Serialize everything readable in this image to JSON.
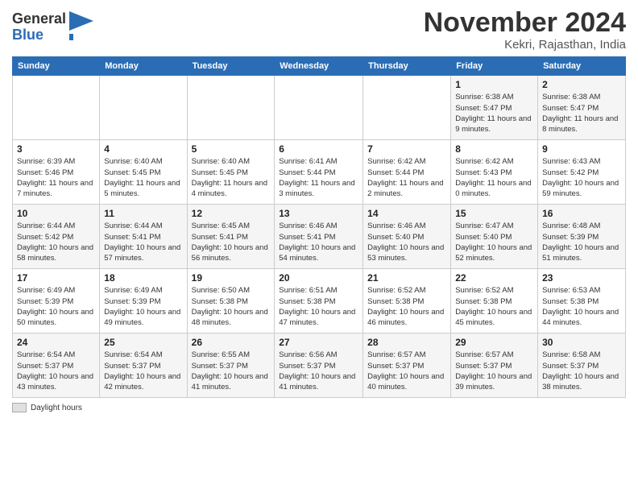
{
  "logo": {
    "general": "General",
    "blue": "Blue"
  },
  "header": {
    "month": "November 2024",
    "location": "Kekri, Rajasthan, India"
  },
  "days_of_week": [
    "Sunday",
    "Monday",
    "Tuesday",
    "Wednesday",
    "Thursday",
    "Friday",
    "Saturday"
  ],
  "weeks": [
    [
      {
        "day": "",
        "info": ""
      },
      {
        "day": "",
        "info": ""
      },
      {
        "day": "",
        "info": ""
      },
      {
        "day": "",
        "info": ""
      },
      {
        "day": "",
        "info": ""
      },
      {
        "day": "1",
        "info": "Sunrise: 6:38 AM\nSunset: 5:47 PM\nDaylight: 11 hours and 9 minutes."
      },
      {
        "day": "2",
        "info": "Sunrise: 6:38 AM\nSunset: 5:47 PM\nDaylight: 11 hours and 8 minutes."
      }
    ],
    [
      {
        "day": "3",
        "info": "Sunrise: 6:39 AM\nSunset: 5:46 PM\nDaylight: 11 hours and 7 minutes."
      },
      {
        "day": "4",
        "info": "Sunrise: 6:40 AM\nSunset: 5:45 PM\nDaylight: 11 hours and 5 minutes."
      },
      {
        "day": "5",
        "info": "Sunrise: 6:40 AM\nSunset: 5:45 PM\nDaylight: 11 hours and 4 minutes."
      },
      {
        "day": "6",
        "info": "Sunrise: 6:41 AM\nSunset: 5:44 PM\nDaylight: 11 hours and 3 minutes."
      },
      {
        "day": "7",
        "info": "Sunrise: 6:42 AM\nSunset: 5:44 PM\nDaylight: 11 hours and 2 minutes."
      },
      {
        "day": "8",
        "info": "Sunrise: 6:42 AM\nSunset: 5:43 PM\nDaylight: 11 hours and 0 minutes."
      },
      {
        "day": "9",
        "info": "Sunrise: 6:43 AM\nSunset: 5:42 PM\nDaylight: 10 hours and 59 minutes."
      }
    ],
    [
      {
        "day": "10",
        "info": "Sunrise: 6:44 AM\nSunset: 5:42 PM\nDaylight: 10 hours and 58 minutes."
      },
      {
        "day": "11",
        "info": "Sunrise: 6:44 AM\nSunset: 5:41 PM\nDaylight: 10 hours and 57 minutes."
      },
      {
        "day": "12",
        "info": "Sunrise: 6:45 AM\nSunset: 5:41 PM\nDaylight: 10 hours and 56 minutes."
      },
      {
        "day": "13",
        "info": "Sunrise: 6:46 AM\nSunset: 5:41 PM\nDaylight: 10 hours and 54 minutes."
      },
      {
        "day": "14",
        "info": "Sunrise: 6:46 AM\nSunset: 5:40 PM\nDaylight: 10 hours and 53 minutes."
      },
      {
        "day": "15",
        "info": "Sunrise: 6:47 AM\nSunset: 5:40 PM\nDaylight: 10 hours and 52 minutes."
      },
      {
        "day": "16",
        "info": "Sunrise: 6:48 AM\nSunset: 5:39 PM\nDaylight: 10 hours and 51 minutes."
      }
    ],
    [
      {
        "day": "17",
        "info": "Sunrise: 6:49 AM\nSunset: 5:39 PM\nDaylight: 10 hours and 50 minutes."
      },
      {
        "day": "18",
        "info": "Sunrise: 6:49 AM\nSunset: 5:39 PM\nDaylight: 10 hours and 49 minutes."
      },
      {
        "day": "19",
        "info": "Sunrise: 6:50 AM\nSunset: 5:38 PM\nDaylight: 10 hours and 48 minutes."
      },
      {
        "day": "20",
        "info": "Sunrise: 6:51 AM\nSunset: 5:38 PM\nDaylight: 10 hours and 47 minutes."
      },
      {
        "day": "21",
        "info": "Sunrise: 6:52 AM\nSunset: 5:38 PM\nDaylight: 10 hours and 46 minutes."
      },
      {
        "day": "22",
        "info": "Sunrise: 6:52 AM\nSunset: 5:38 PM\nDaylight: 10 hours and 45 minutes."
      },
      {
        "day": "23",
        "info": "Sunrise: 6:53 AM\nSunset: 5:38 PM\nDaylight: 10 hours and 44 minutes."
      }
    ],
    [
      {
        "day": "24",
        "info": "Sunrise: 6:54 AM\nSunset: 5:37 PM\nDaylight: 10 hours and 43 minutes."
      },
      {
        "day": "25",
        "info": "Sunrise: 6:54 AM\nSunset: 5:37 PM\nDaylight: 10 hours and 42 minutes."
      },
      {
        "day": "26",
        "info": "Sunrise: 6:55 AM\nSunset: 5:37 PM\nDaylight: 10 hours and 41 minutes."
      },
      {
        "day": "27",
        "info": "Sunrise: 6:56 AM\nSunset: 5:37 PM\nDaylight: 10 hours and 41 minutes."
      },
      {
        "day": "28",
        "info": "Sunrise: 6:57 AM\nSunset: 5:37 PM\nDaylight: 10 hours and 40 minutes."
      },
      {
        "day": "29",
        "info": "Sunrise: 6:57 AM\nSunset: 5:37 PM\nDaylight: 10 hours and 39 minutes."
      },
      {
        "day": "30",
        "info": "Sunrise: 6:58 AM\nSunset: 5:37 PM\nDaylight: 10 hours and 38 minutes."
      }
    ]
  ],
  "footer": {
    "legend_label": "Daylight hours"
  }
}
